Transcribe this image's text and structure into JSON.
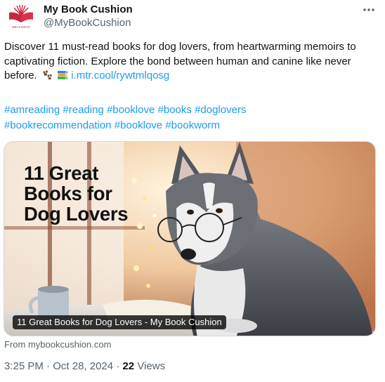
{
  "author": {
    "display_name": "My Book Cushion",
    "handle": "@MyBookCushion",
    "avatar_text": "MBCUSHION"
  },
  "tweet": {
    "text": "Discover 11 must-read books for dog lovers, from heartwarming memoirs to captivating fiction. Explore the bond between human and canine like never before.",
    "emojis": [
      "paw-prints-icon",
      "books-icon"
    ],
    "link": "i.mtr.cool/rywtmlqosg",
    "hashtags": [
      "#amreading",
      "#reading",
      "#booklove",
      "#books",
      "#doglovers",
      "#bookrecommendation",
      "#booklove",
      "#bookworm"
    ]
  },
  "card": {
    "headline": [
      "11 Great",
      "Books for",
      "Dog Lovers"
    ],
    "label": "11 Great Books for Dog Lovers - My Book Cushion",
    "source": "From mybookcushion.com"
  },
  "meta": {
    "time": "3:25 PM",
    "separator": "·",
    "date": "Oct 28, 2024",
    "views_count": "22",
    "views_label": "Views"
  },
  "colors": {
    "link": "#1d9bf0",
    "secondary_text": "#536471",
    "primary_text": "#0f1419"
  }
}
